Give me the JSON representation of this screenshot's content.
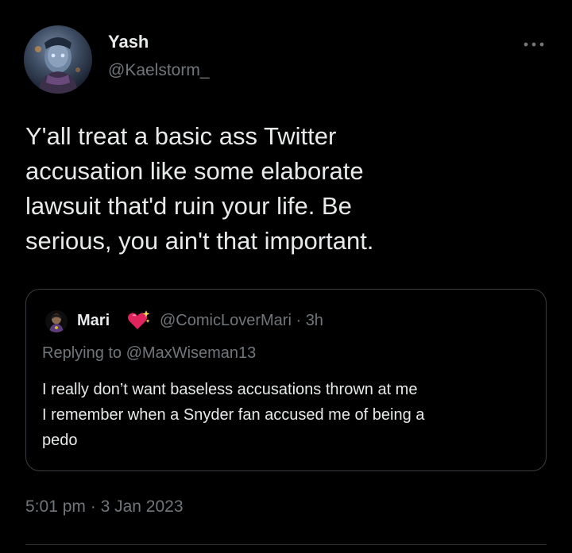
{
  "tweet": {
    "author": {
      "name": "Yash",
      "handle": "@Kaelstorm_"
    },
    "more_icon": "more-options-icon",
    "text_lines": [
      "Y'all treat a basic ass Twitter",
      "accusation like some elaborate",
      "lawsuit that'd ruin your life. Be",
      "serious, you ain't that important."
    ],
    "quoted": {
      "name": "Mari",
      "name_emoji": "sparkling-heart-icon",
      "handle": "@ComicLoverMari",
      "separator": "·",
      "time_ago": "3h",
      "replying_to": "Replying to @MaxWiseman13",
      "text_lines": [
        "I really don’t want baseless accusations thrown at me",
        "I remember when a Snyder fan accused me of being a",
        "pedo"
      ]
    },
    "timestamp": {
      "time": "5:01 pm",
      "separator": "·",
      "date": "3 Jan 2023"
    }
  },
  "colors": {
    "background": "#000000",
    "primary_text": "#e7e9ea",
    "secondary_text": "#71767b",
    "border": "#3a3d41",
    "heart": "#e0245e"
  }
}
